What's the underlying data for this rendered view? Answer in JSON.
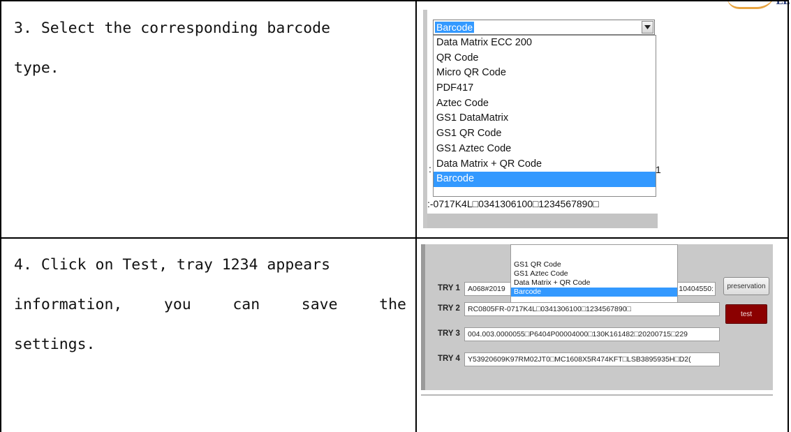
{
  "header": {
    "logo_text": "LL"
  },
  "rows": [
    {
      "step_text_lines": [
        "3. Select the corresponding barcode",
        "type."
      ],
      "screenshot": {
        "combo_value": "Barcode",
        "options": [
          "Data Matrix ECC 200",
          "QR Code",
          "Micro QR Code",
          "PDF417",
          "Aztec Code",
          "GS1 DataMatrix",
          "GS1 QR Code",
          "GS1 Aztec Code",
          "Data Matrix + QR Code",
          "Barcode"
        ],
        "selected_option": "Barcode",
        "peek_left": ":",
        "peek_right": "1",
        "result_text": ":-0717K4L□0341306100□1234567890□"
      }
    },
    {
      "step_text_lines": [
        "4. Click on Test, tray 1234 appears",
        "information, you can save the",
        "settings."
      ],
      "screenshot": {
        "dropdown_options": [
          "GS1 QR Code",
          "GS1 Aztec Code",
          "Data Matrix + QR Code",
          "Barcode"
        ],
        "selected_option": "Barcode",
        "tries": [
          {
            "label": "TRY 1",
            "value": "A068#2019",
            "value_right": "10404550:"
          },
          {
            "label": "TRY 2",
            "value": "RC0805FR-0717K4L□0341306100□1234567890□"
          },
          {
            "label": "TRY 3",
            "value": "004.003.0000055□P6404P00004000□130K161482□20200715□229"
          },
          {
            "label": "TRY 4",
            "value": "Y53920609K97RM02JT0□MC1608X5R474KFT□LSB3895935H□D2("
          }
        ],
        "preservation_label": "preservation",
        "test_label": "test"
      }
    }
  ]
}
